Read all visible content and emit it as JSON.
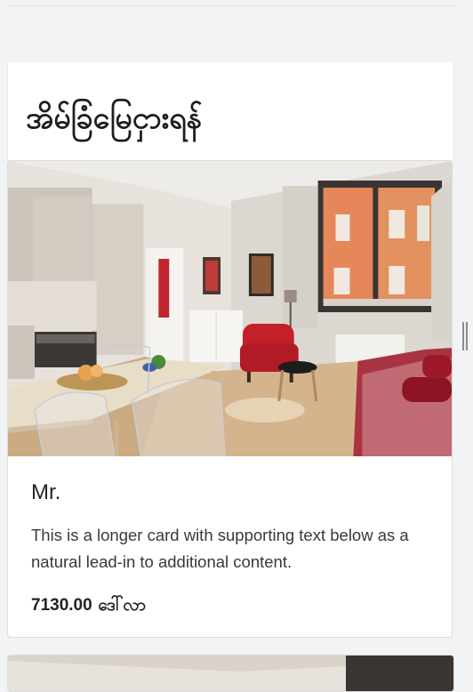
{
  "page": {
    "title": "အိမ်ခြံမြေငှားရန်"
  },
  "listing": {
    "title": "Mr.",
    "description": "This is a longer card with supporting text below as a natural lead-in to additional content.",
    "price": "7130.00",
    "currency": "ဒေါ်လာ"
  },
  "colors": {
    "page_background": "#f2f3f4",
    "card_background": "#ffffff",
    "text": "#212529"
  }
}
